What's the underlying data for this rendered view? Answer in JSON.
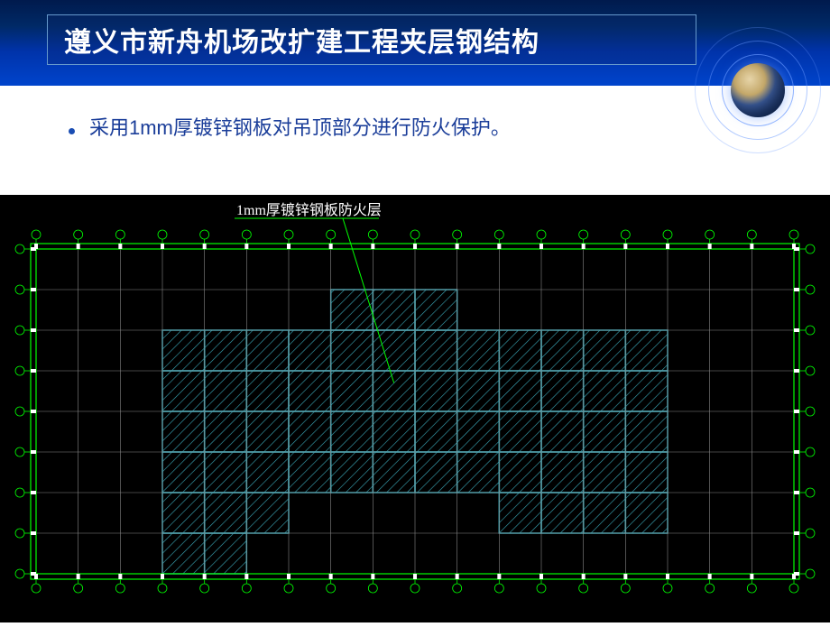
{
  "header": {
    "title": "遵义市新舟机场改扩建工程夹层钢结构"
  },
  "content": {
    "bullet_text": "采用1mm厚镀锌钢板对吊顶部分进行防火保护。"
  },
  "cad": {
    "annotation": "1mm厚镀锌钢板防火层",
    "colors": {
      "grid_outer": "#00ff00",
      "grid_inner": "#888888",
      "hatch": "#3aa8b8",
      "text": "#ffffff",
      "leader": "#00ff00"
    },
    "layout": {
      "cols": 18,
      "rows": 8,
      "hatched_cells": [
        [
          1,
          7
        ],
        [
          1,
          8
        ],
        [
          1,
          9
        ],
        [
          2,
          3
        ],
        [
          2,
          4
        ],
        [
          2,
          5
        ],
        [
          2,
          6
        ],
        [
          2,
          7
        ],
        [
          2,
          8
        ],
        [
          2,
          9
        ],
        [
          2,
          10
        ],
        [
          2,
          11
        ],
        [
          2,
          12
        ],
        [
          2,
          13
        ],
        [
          2,
          14
        ],
        [
          3,
          3
        ],
        [
          3,
          4
        ],
        [
          3,
          5
        ],
        [
          3,
          6
        ],
        [
          3,
          7
        ],
        [
          3,
          8
        ],
        [
          3,
          9
        ],
        [
          3,
          10
        ],
        [
          3,
          11
        ],
        [
          3,
          12
        ],
        [
          3,
          13
        ],
        [
          3,
          14
        ],
        [
          4,
          3
        ],
        [
          4,
          4
        ],
        [
          4,
          5
        ],
        [
          4,
          6
        ],
        [
          4,
          7
        ],
        [
          4,
          8
        ],
        [
          4,
          9
        ],
        [
          4,
          10
        ],
        [
          4,
          11
        ],
        [
          4,
          12
        ],
        [
          4,
          13
        ],
        [
          4,
          14
        ],
        [
          5,
          3
        ],
        [
          5,
          4
        ],
        [
          5,
          5
        ],
        [
          5,
          6
        ],
        [
          5,
          7
        ],
        [
          5,
          8
        ],
        [
          5,
          9
        ],
        [
          5,
          10
        ],
        [
          5,
          11
        ],
        [
          5,
          12
        ],
        [
          5,
          13
        ],
        [
          5,
          14
        ],
        [
          6,
          3
        ],
        [
          6,
          4
        ],
        [
          6,
          5
        ],
        [
          6,
          11
        ],
        [
          6,
          12
        ],
        [
          6,
          13
        ],
        [
          6,
          14
        ],
        [
          7,
          3
        ],
        [
          7,
          4
        ]
      ],
      "annotation_target_cell": [
        3,
        8
      ]
    }
  }
}
